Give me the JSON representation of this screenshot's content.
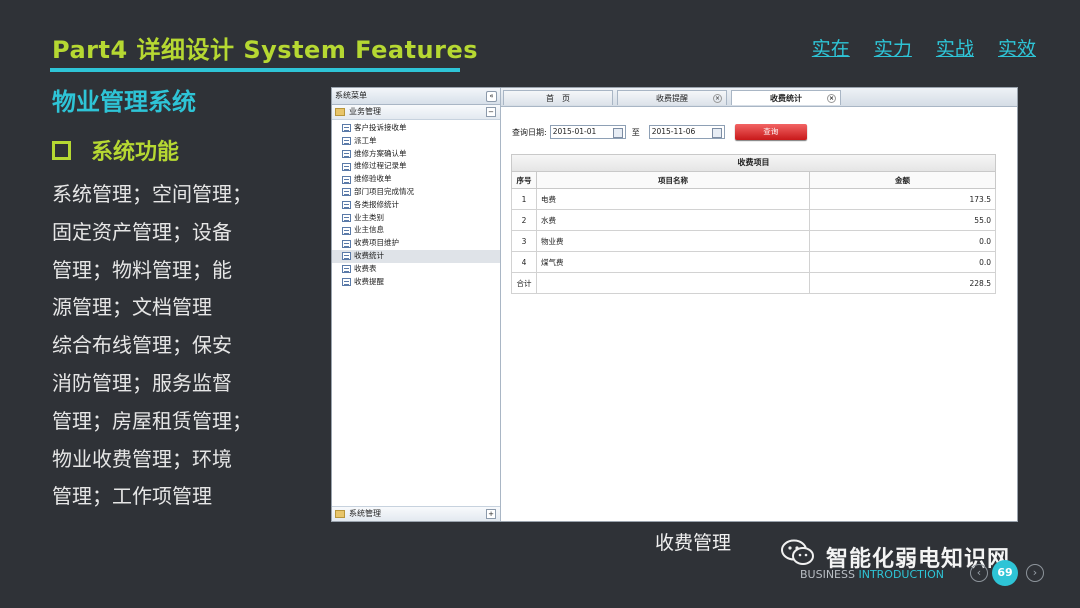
{
  "slide": {
    "title": "Part4 详细设计 System Features",
    "top_links": [
      "实在",
      "实力",
      "实战",
      "实效"
    ],
    "subtitle": "物业管理系统",
    "section_title": "系统功能",
    "body_lines": [
      "系统管理；空间管理；",
      "固定资产管理；设备",
      "管理；物料管理；能",
      "源管理；文档管理",
      "综合布线管理；保安",
      "消防管理；服务监督",
      "管理；房屋租赁管理；",
      "物业收费管理；环境",
      "管理；工作项管理"
    ],
    "caption": "收费管理",
    "brand": "智能化弱电知识网",
    "biz_prefix": "BUSINESS ",
    "biz_highlight": "INTRODUCTION",
    "page_number": "69",
    "colors": {
      "accent_green": "#b6d832",
      "accent_cyan": "#2ec4d6",
      "background": "#2f3237"
    }
  },
  "app": {
    "sidebar": {
      "header": "系统菜单",
      "collapse_icon": "«",
      "group_top": "业务管理",
      "group_top_toggle": "−",
      "items": [
        "客户投诉接收单",
        "派工单",
        "维修方案确认单",
        "维修过程记录单",
        "维修验收单",
        "部门项目完成情况",
        "各类报修统计",
        "业主类别",
        "业主信息",
        "收费项目维护",
        "收费统计",
        "收费表",
        "收费提醒"
      ],
      "active_item": "收费统计",
      "group_bottom": "系统管理",
      "group_bottom_toggle": "+"
    },
    "tabs": [
      {
        "label": "首　页",
        "closable": false
      },
      {
        "label": "收费提醒",
        "closable": true
      },
      {
        "label": "收费统计",
        "closable": true,
        "active": true
      }
    ],
    "query": {
      "label": "查询日期:",
      "start_date": "2015-01-01",
      "to_label": "至",
      "end_date": "2015-11-06",
      "button": "查询"
    },
    "table": {
      "caption": "收费项目",
      "headers": [
        "序号",
        "项目名称",
        "金额"
      ],
      "rows": [
        {
          "idx": "1",
          "name": "电费",
          "amount": "173.5"
        },
        {
          "idx": "2",
          "name": "水费",
          "amount": "55.0"
        },
        {
          "idx": "3",
          "name": "物业费",
          "amount": "0.0"
        },
        {
          "idx": "4",
          "name": "煤气费",
          "amount": "0.0"
        }
      ],
      "total_label": "合计",
      "total_amount": "228.5"
    }
  }
}
